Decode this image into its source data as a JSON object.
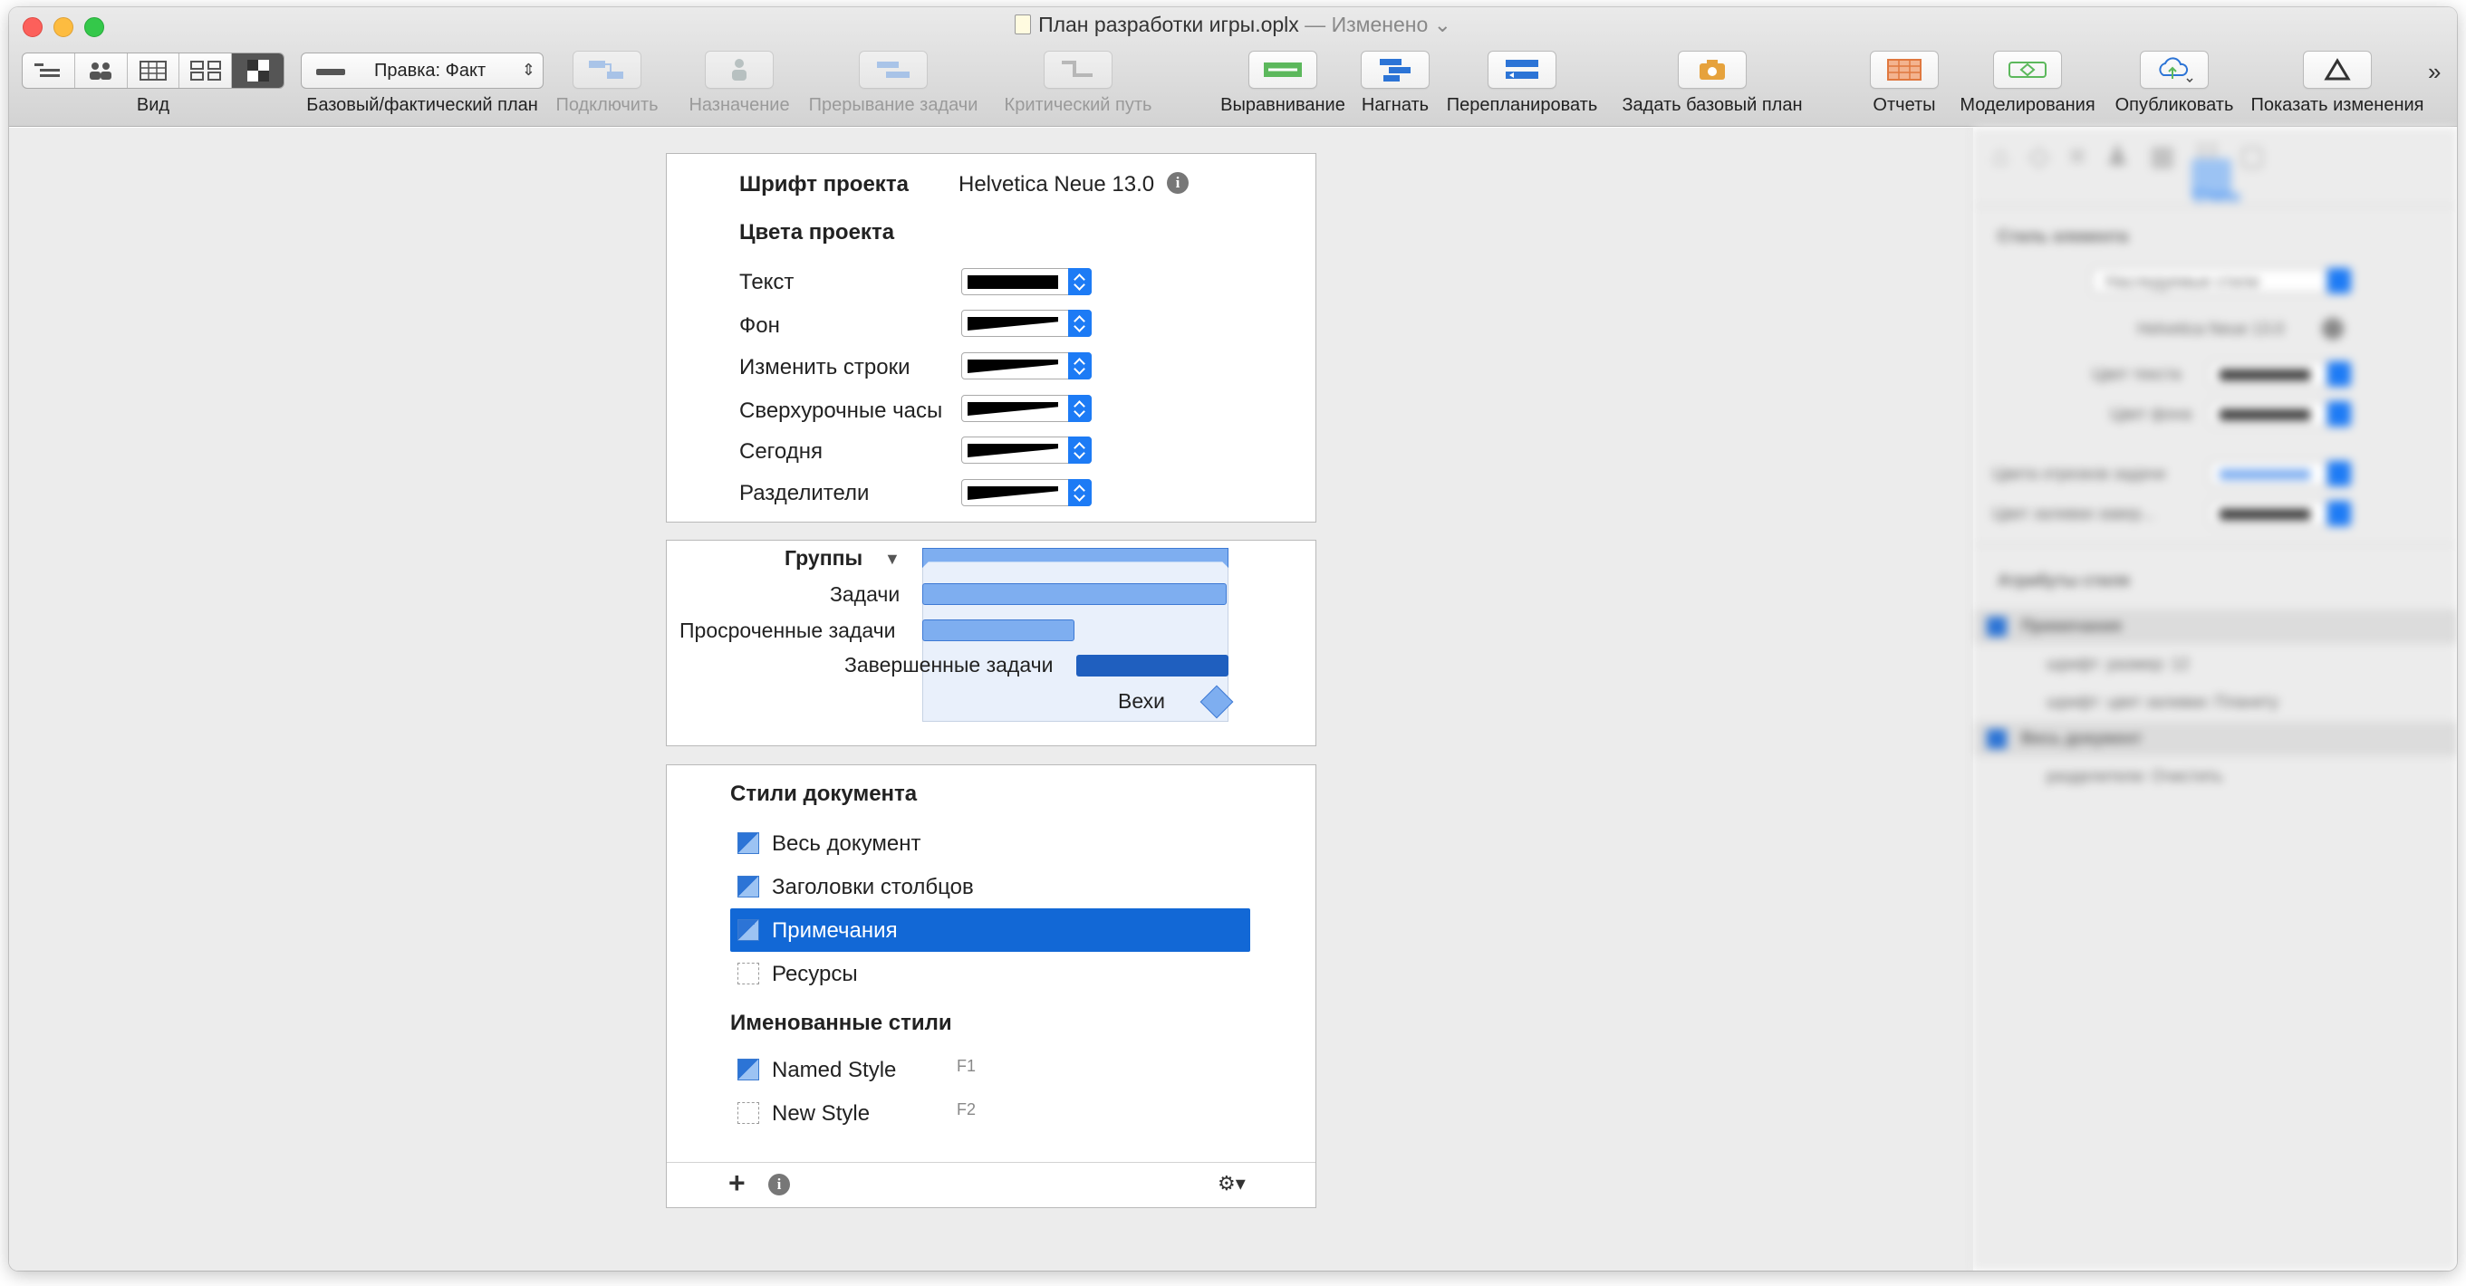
{
  "window": {
    "title": "План разработки игры.oplx",
    "separator": " — ",
    "subtitle": "Изменено"
  },
  "toolbar": {
    "view_label": "Вид",
    "baseline_popup_value": "Правка: Факт",
    "baseline_label": "Базовый/фактический план",
    "items": [
      {
        "label": "Подключить",
        "enabled": false
      },
      {
        "label": "Назначение",
        "enabled": false
      },
      {
        "label": "Прерывание задачи",
        "enabled": false
      },
      {
        "label": "Критический путь",
        "enabled": false
      },
      {
        "label": "Выравнивание",
        "enabled": true
      },
      {
        "label": "Нагнать",
        "enabled": true
      },
      {
        "label": "Перепланировать",
        "enabled": true
      },
      {
        "label": "Задать базовый план",
        "enabled": true
      },
      {
        "label": "Отчеты",
        "enabled": true
      },
      {
        "label": "Моделирования",
        "enabled": true
      },
      {
        "label": "Опубликовать",
        "enabled": true
      },
      {
        "label": "Показать изменения",
        "enabled": true
      }
    ],
    "overflow": "»"
  },
  "project_panel": {
    "font_label": "Шрифт проекта",
    "font_value": "Helvetica Neue 13.0",
    "colors_heading": "Цвета проекта",
    "colors": [
      {
        "label": "Текст",
        "style": "solid"
      },
      {
        "label": "Фон",
        "style": "gradient"
      },
      {
        "label": "Изменить строки",
        "style": "gradient"
      },
      {
        "label": "Сверхурочные часы",
        "style": "gradient"
      },
      {
        "label": "Сегодня",
        "style": "gradient"
      },
      {
        "label": "Разделители",
        "style": "gradient"
      }
    ]
  },
  "legend_panel": {
    "groups": "Группы",
    "tasks": "Задачи",
    "overdue": "Просроченные задачи",
    "completed": "Завершенные задачи",
    "milestones": "Вехи"
  },
  "styles_panel": {
    "doc_styles_heading": "Стили документа",
    "doc_styles": [
      {
        "label": "Весь документ",
        "icon": "style-icon",
        "selected": false
      },
      {
        "label": "Заголовки столбцов",
        "icon": "style-icon",
        "selected": false
      },
      {
        "label": "Примечания",
        "icon": "style-icon",
        "selected": true
      },
      {
        "label": "Ресурсы",
        "icon": "empty-style-icon",
        "selected": false
      }
    ],
    "named_styles_heading": "Именованные стили",
    "named_styles": [
      {
        "label": "Named Style",
        "key": "F1"
      },
      {
        "label": "New Style",
        "key": "F2"
      }
    ],
    "add_symbol": "+",
    "info_symbol": "i",
    "gear_symbol": "⚙▾"
  },
  "inspector": {
    "tab_icons": "⌂◇≡♟▦☷▢",
    "tab_title": "Стили",
    "sections": [
      "Стиль элемента",
      "Атрибуты стиля"
    ],
    "style_popup": "Наследуемые стили",
    "font": "Helvetica Neue 13.0",
    "rows": [
      "Цвет текста",
      "Цвет фона",
      "Цвета отрезков задачи",
      "Цвет заливки завер..."
    ],
    "attr_rows": [
      "Примечания",
      "шрифт: размер: 12",
      "шрифт: цвет заливки: Планету",
      "Весь документ",
      "разделители: Очистить"
    ]
  },
  "colors": {
    "accent": "#1268d6",
    "bar_light": "#7eaef0",
    "bar_dark": "#1f5fbf",
    "milestone": "#7eaef0"
  }
}
